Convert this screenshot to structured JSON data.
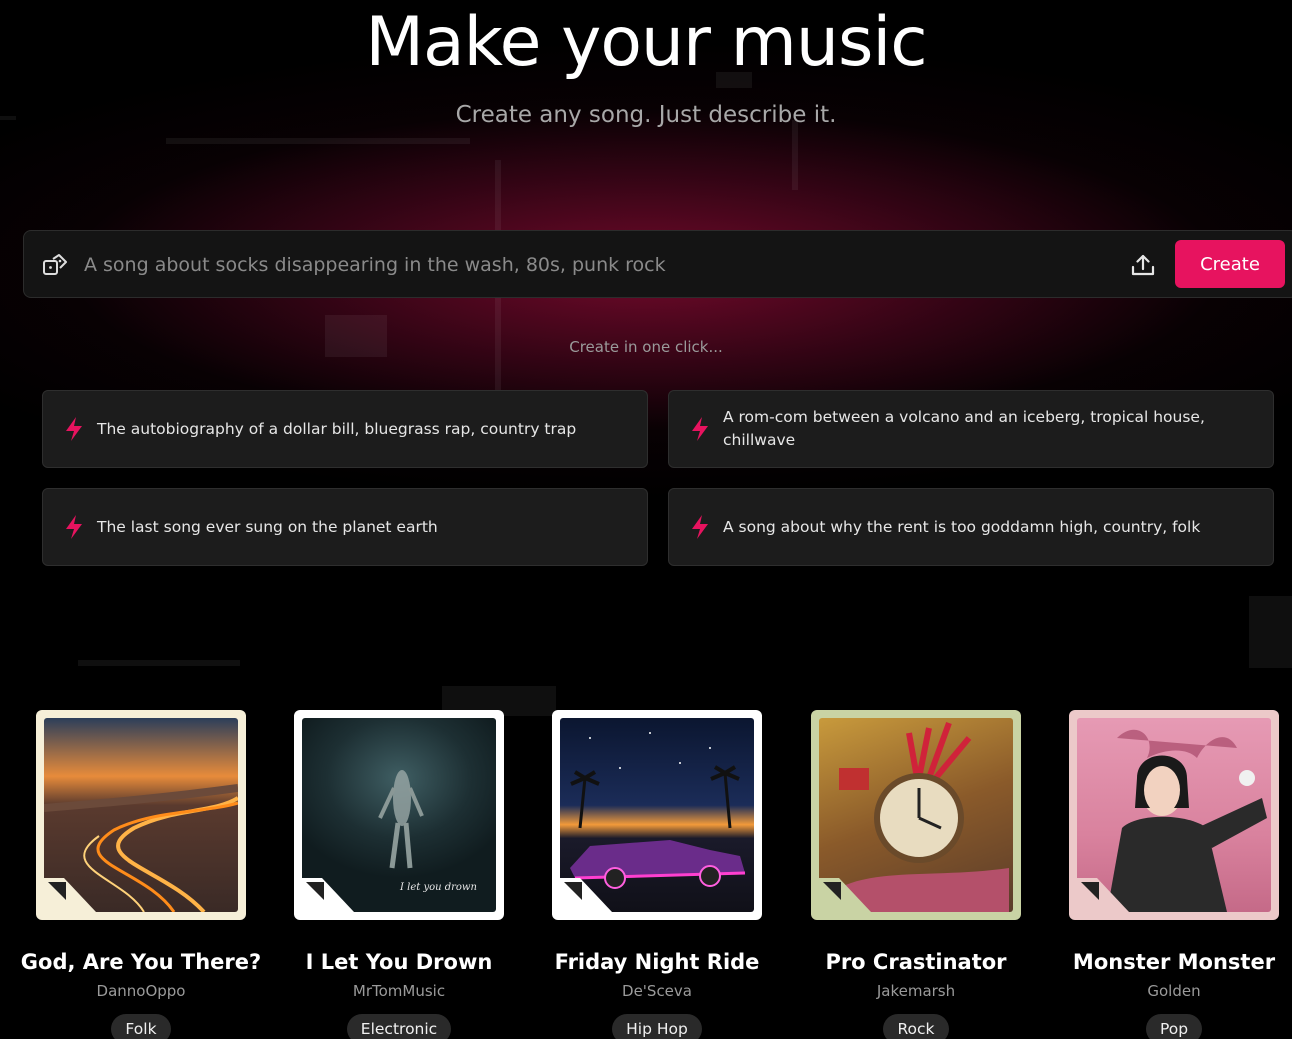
{
  "hero": {
    "title": "Make your music",
    "subtitle": "Create any song. Just describe it."
  },
  "prompt": {
    "placeholder": "A song about socks disappearing in the wash, 80s, punk rock",
    "create_label": "Create",
    "left_icon": "shuffle-dice-icon",
    "upload_icon": "upload-icon"
  },
  "one_click_label": "Create in one click...",
  "suggestions": [
    {
      "text": "The autobiography of a dollar bill, bluegrass rap, country trap",
      "icon": "bolt-icon"
    },
    {
      "text": "A rom-com between a volcano and an iceberg, tropical house, chillwave",
      "icon": "bolt-icon"
    },
    {
      "text": "The last song ever sung on the planet earth",
      "icon": "bolt-icon"
    },
    {
      "text": "A song about why the rent is too goddamn high, country, folk",
      "icon": "bolt-icon"
    }
  ],
  "songs": [
    {
      "title": "God, Are You There?",
      "artist": "DannoOppo",
      "genre": "Folk",
      "frame_color": "#f6efd8"
    },
    {
      "title": "I Let You Drown",
      "artist": "MrTomMusic",
      "genre": "Electronic",
      "frame_color": "#ffffff",
      "cover_text": "I let you drown"
    },
    {
      "title": "Friday Night Ride",
      "artist": "De'Sceva",
      "genre": "Hip Hop",
      "frame_color": "#ffffff"
    },
    {
      "title": "Pro Crastinator",
      "artist": "Jakemarsh",
      "genre": "Rock",
      "frame_color": "#c9d3a4"
    },
    {
      "title": "Monster Monster",
      "artist": "Golden",
      "genre": "Pop",
      "frame_color": "#ecc9c9"
    }
  ],
  "colors": {
    "accent": "#e7135f",
    "background": "#000000",
    "card": "#1c1c1c"
  }
}
